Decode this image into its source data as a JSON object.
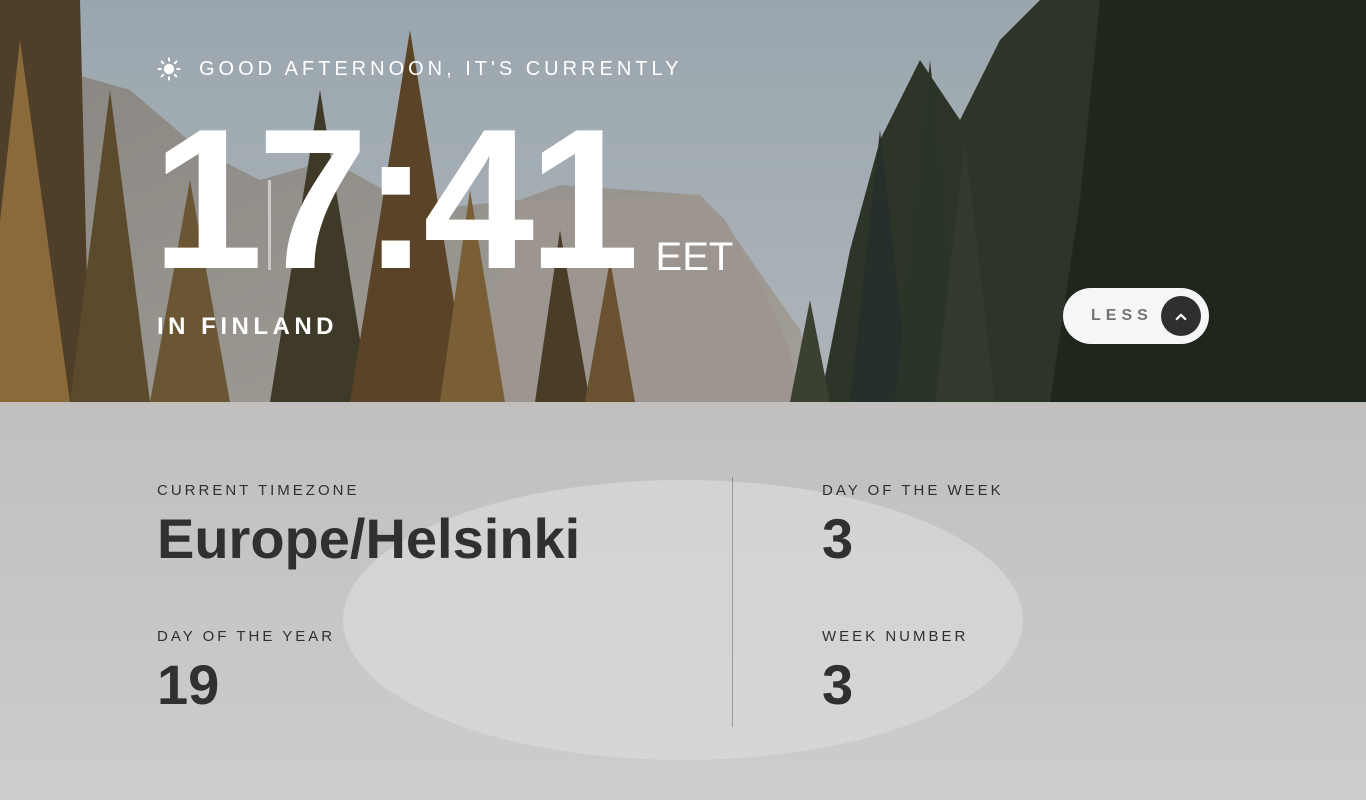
{
  "hero": {
    "icon": "sun-icon",
    "greeting": "Good afternoon, it's currently",
    "time": "17:41",
    "timezone_abbr": "EET",
    "location": "In Finland"
  },
  "toggle": {
    "label": "Less",
    "icon": "chevron-up-icon"
  },
  "details": {
    "timezone": {
      "label": "Current timezone",
      "value": "Europe/Helsinki"
    },
    "day_of_week": {
      "label": "Day of the week",
      "value": "3"
    },
    "day_of_year": {
      "label": "Day of the year",
      "value": "19"
    },
    "week_number": {
      "label": "Week number",
      "value": "3"
    }
  },
  "colors": {
    "text_light": "#ffffff",
    "text_dark": "#303030",
    "button_bg": "#ffffff",
    "button_icon_bg": "#303030",
    "panel_bg": "#e1e1e1"
  }
}
